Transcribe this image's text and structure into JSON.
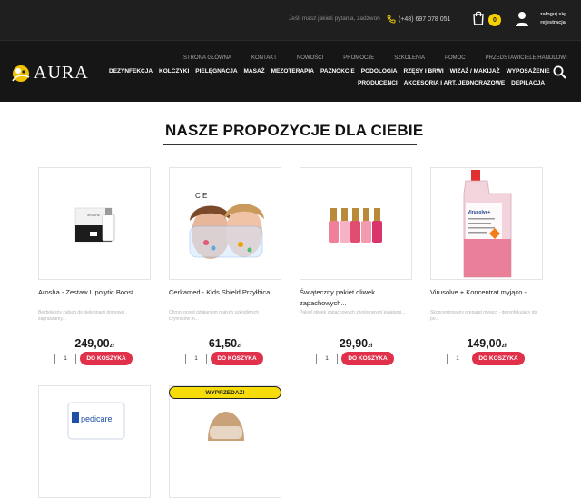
{
  "topbar": {
    "hint": "Jeśli masz jakieś pytania, zadzwoń",
    "phone": "(+48) 697 078 051",
    "cart_count": "0",
    "login_line1": "zaloguj się",
    "login_line2": "rejestracja"
  },
  "logo": {
    "text": "AURA"
  },
  "nav": {
    "row1": [
      "STRONA GŁÓWNA",
      "KONTAKT",
      "NOWOŚCI",
      "PROMOCJE",
      "SZKOLENIA",
      "POMOC",
      "PRZEDSTAWICIELE HANDLOWI"
    ],
    "row2": [
      "DEZYNFEKCJA",
      "KOLCZYKI",
      "PIELĘGNACJA",
      "MASAŻ",
      "MEZOTERAPIA",
      "PAZNOKCIE",
      "PODOLOGIA",
      "RZĘSY I BRWI",
      "WIZAŻ / MAKIJAŻ",
      "WYPOSAŻENIE"
    ],
    "row3": [
      "PRODUCENCI",
      "AKCESORIA I ART. JEDNORAZOWE",
      "DEPILACJA"
    ]
  },
  "section": {
    "heading": "NASZE PROPOZYCJE DLA CIEBIE"
  },
  "products": [
    {
      "name": "Arosha - Zestaw Lipolytic Boost...",
      "desc": "Bezbolesny zabieg do pielęgnacji domowej, zapraszamy...",
      "price": "249,00",
      "currency": "zł",
      "qty": "1",
      "buy_label": "DO KOSZYKA"
    },
    {
      "name": "Cerkamed - Kids Shield Przyłbica...",
      "desc": "Chroni przed działaniem małych szkodliwych czynników m...",
      "price": "61,50",
      "currency": "zł",
      "qty": "1",
      "buy_label": "DO KOSZYKA"
    },
    {
      "name": "Świąteczny pakiet oliwek zapachowych...",
      "desc": "Pakiet oliwek zapachowych z kolorowymi kwiatami...",
      "price": "29,90",
      "currency": "zł",
      "qty": "1",
      "buy_label": "DO KOSZYKA"
    },
    {
      "name": "Virusolve + Koncentrat myjąco -...",
      "desc": "Skoncentrowany preparat myjąco - dezynfekujący do po...",
      "price": "149,00",
      "currency": "zł",
      "qty": "1",
      "buy_label": "DO KOSZYKA"
    }
  ],
  "second_row": {
    "sale_label": "WYPRZEDAŻ!",
    "brand_label": "pedicare"
  },
  "product_image_text": {
    "arosha_label": "AROSHA",
    "ce_mark": "C E",
    "virusolve_label": "Virusolve+"
  },
  "colors": {
    "accent": "#e0304a",
    "badge": "#f7d100",
    "dark": "#1f1f1f"
  }
}
